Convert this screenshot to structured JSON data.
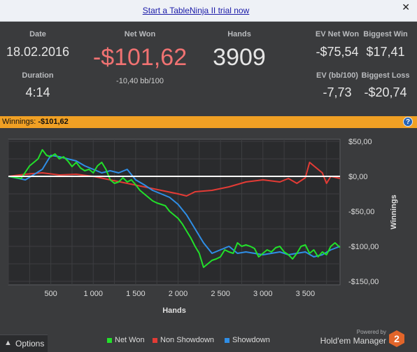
{
  "banner": {
    "link_text": "Start a TableNinja II trial now",
    "close_glyph": "✕"
  },
  "stats": {
    "date_label": "Date",
    "date_value": "18.02.2016",
    "duration_label": "Duration",
    "duration_value": "4:14",
    "netwon_label": "Net Won",
    "netwon_value": "-$101,62",
    "netwon_sub": "-10,40 bb/100",
    "hands_label": "Hands",
    "hands_value": "3909",
    "ev_net_won_label": "EV Net Won",
    "ev_net_won_value": "-$75,54",
    "biggest_win_label": "Biggest Win",
    "biggest_win_value": "$17,41",
    "ev_bb_label": "EV (bb/100)",
    "ev_bb_value": "-7,73",
    "biggest_loss_label": "Biggest Loss",
    "biggest_loss_value": "-$20,74"
  },
  "winnings_bar": {
    "label": "Winnings:",
    "value": "-$101,62",
    "help_glyph": "?"
  },
  "colors": {
    "net_won": "#22e02a",
    "non_showdown": "#e33b35",
    "showdown": "#2f8ee6",
    "accent_orange": "#f0a024",
    "net_won_value": "#f07272"
  },
  "chart_data": {
    "type": "line",
    "xlabel": "Hands",
    "ylabel": "Winnings",
    "xlim": [
      0,
      3909
    ],
    "ylim": [
      -155,
      53
    ],
    "x_ticks": [
      500,
      1000,
      1500,
      2000,
      2500,
      3000,
      3500
    ],
    "x_tick_labels": [
      "500",
      "1 000",
      "1 500",
      "2 000",
      "2 500",
      "3 000",
      "3 500"
    ],
    "y_ticks": [
      50,
      0,
      -50,
      -100,
      -150
    ],
    "y_tick_labels": [
      "$50,00",
      "$0,00",
      "-$50,00",
      "-$100,00",
      "-$150,00"
    ],
    "zero_line": true,
    "grid": true,
    "legend_position": "bottom",
    "series": [
      {
        "name": "Net Won",
        "color": "#22e02a",
        "x": [
          0,
          150,
          250,
          300,
          350,
          400,
          450,
          500,
          550,
          600,
          650,
          700,
          750,
          800,
          850,
          900,
          950,
          1000,
          1050,
          1100,
          1150,
          1200,
          1250,
          1300,
          1350,
          1400,
          1450,
          1500,
          1550,
          1600,
          1650,
          1700,
          1750,
          1800,
          1850,
          1900,
          1950,
          2000,
          2050,
          2100,
          2150,
          2200,
          2250,
          2300,
          2350,
          2400,
          2450,
          2500,
          2550,
          2600,
          2650,
          2700,
          2750,
          2800,
          2850,
          2900,
          2950,
          3000,
          3050,
          3100,
          3150,
          3200,
          3250,
          3300,
          3350,
          3400,
          3450,
          3500,
          3550,
          3600,
          3650,
          3700,
          3750,
          3800,
          3850,
          3909
        ],
        "y": [
          0,
          -3,
          15,
          20,
          25,
          38,
          30,
          28,
          32,
          25,
          28,
          22,
          14,
          20,
          12,
          8,
          10,
          5,
          15,
          20,
          10,
          -5,
          -10,
          -8,
          -2,
          -8,
          -5,
          -12,
          -20,
          -25,
          -30,
          -35,
          -38,
          -40,
          -42,
          -50,
          -55,
          -60,
          -68,
          -78,
          -88,
          -100,
          -110,
          -130,
          -125,
          -120,
          -118,
          -115,
          -105,
          -108,
          -110,
          -95,
          -100,
          -98,
          -100,
          -103,
          -115,
          -110,
          -105,
          -108,
          -102,
          -100,
          -108,
          -112,
          -118,
          -110,
          -100,
          -98,
          -110,
          -105,
          -115,
          -108,
          -112,
          -100,
          -95,
          -101.62
        ]
      },
      {
        "name": "Non Showdown",
        "color": "#e33b35",
        "x": [
          0,
          200,
          400,
          600,
          800,
          1000,
          1200,
          1400,
          1600,
          1800,
          2000,
          2100,
          2200,
          2400,
          2600,
          2800,
          3000,
          3200,
          3300,
          3400,
          3500,
          3550,
          3600,
          3650,
          3700,
          3750,
          3800,
          3909
        ],
        "y": [
          0,
          3,
          5,
          2,
          3,
          0,
          -5,
          -10,
          -15,
          -20,
          -25,
          -28,
          -22,
          -20,
          -15,
          -8,
          -5,
          -8,
          -3,
          -10,
          -2,
          20,
          15,
          10,
          5,
          -10,
          0,
          -3
        ]
      },
      {
        "name": "Showdown",
        "color": "#2f8ee6",
        "x": [
          0,
          200,
          400,
          500,
          600,
          700,
          800,
          900,
          1000,
          1100,
          1200,
          1300,
          1400,
          1500,
          1600,
          1700,
          1800,
          1900,
          2000,
          2100,
          2200,
          2300,
          2400,
          2500,
          2600,
          2700,
          2800,
          2900,
          3000,
          3100,
          3200,
          3300,
          3400,
          3500,
          3600,
          3700,
          3800,
          3909
        ],
        "y": [
          0,
          -5,
          10,
          30,
          28,
          25,
          22,
          15,
          10,
          5,
          8,
          5,
          10,
          -5,
          -12,
          -20,
          -25,
          -30,
          -40,
          -55,
          -75,
          -95,
          -110,
          -105,
          -100,
          -110,
          -108,
          -110,
          -112,
          -110,
          -108,
          -112,
          -110,
          -108,
          -115,
          -112,
          -105,
          -100
        ]
      }
    ]
  },
  "footer": {
    "options_label": "Options",
    "options_arrow": "▲",
    "powered_by": "Powered by",
    "brand_name": "Hold'em Manager",
    "brand_version": "2"
  }
}
